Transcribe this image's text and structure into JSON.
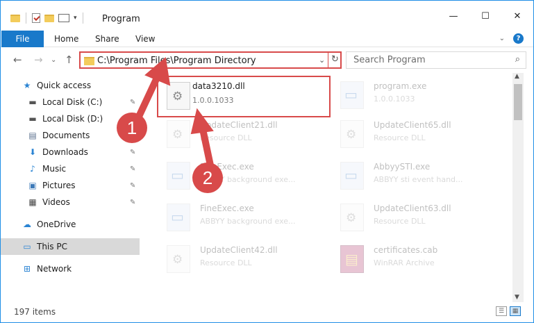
{
  "window": {
    "title": "Program",
    "minimize": "—",
    "maximize": "☐",
    "close": "✕"
  },
  "ribbon": {
    "tabs": [
      "File",
      "Home",
      "Share",
      "View"
    ],
    "collapse": "⌄",
    "help": "?"
  },
  "address": {
    "path": "C:\\Program Files\\Program Directory",
    "dropdown": "⌄",
    "refresh": "↻"
  },
  "nav": {
    "back": "←",
    "forward": "→",
    "recent": "⌄",
    "up": "↑"
  },
  "search": {
    "placeholder": "Search Program",
    "icon": "⌕"
  },
  "sidebar": {
    "items": [
      {
        "label": "Quick access",
        "icon": "star-icon",
        "glyph": "★",
        "color": "#2b84d3"
      },
      {
        "label": "Local Disk (C:)",
        "icon": "drive-icon",
        "glyph": "▬",
        "color": "#555555",
        "pinned": true
      },
      {
        "label": "Local Disk (D:)",
        "icon": "drive-icon",
        "glyph": "▬",
        "color": "#555555",
        "pinned": false
      },
      {
        "label": "Documents",
        "icon": "documents-icon",
        "glyph": "▤",
        "color": "#5a6f8c",
        "pinned": true
      },
      {
        "label": "Downloads",
        "icon": "downloads-icon",
        "glyph": "⬇",
        "color": "#2b84d3",
        "pinned": true
      },
      {
        "label": "Music",
        "icon": "music-icon",
        "glyph": "♪",
        "color": "#2b84d3",
        "pinned": true
      },
      {
        "label": "Pictures",
        "icon": "pictures-icon",
        "glyph": "▣",
        "color": "#3d7ab8",
        "pinned": true
      },
      {
        "label": "Videos",
        "icon": "videos-icon",
        "glyph": "▦",
        "color": "#444444",
        "pinned": true
      },
      {
        "label": "OneDrive",
        "icon": "cloud-icon",
        "glyph": "☁",
        "color": "#2b84d3"
      },
      {
        "label": "This PC",
        "icon": "computer-icon",
        "glyph": "▭",
        "color": "#2b84d3",
        "selected": true
      },
      {
        "label": "Network",
        "icon": "network-icon",
        "glyph": "⊞",
        "color": "#2b84d3"
      }
    ],
    "pin_glyph": "📌"
  },
  "files": [
    {
      "name": "data3210.dll",
      "sub": "1.0.0.1033",
      "kind": "dll"
    },
    {
      "name": "program.exe",
      "sub": "1.0.0.1033",
      "kind": "exe"
    },
    {
      "name": "UpdateClient21.dll",
      "sub": "Resource DLL",
      "kind": "dll"
    },
    {
      "name": "UpdateClient65.dll",
      "sub": "Resource DLL",
      "kind": "dll"
    },
    {
      "name": "FineExec.exe",
      "sub": "ABBYY background exe...",
      "kind": "exe"
    },
    {
      "name": "AbbyySTI.exe",
      "sub": "ABBYY sti event hand...",
      "kind": "exe"
    },
    {
      "name": "FineExec.exe",
      "sub": "ABBYY background exe...",
      "kind": "exe"
    },
    {
      "name": "UpdateClient63.dll",
      "sub": "Resource DLL",
      "kind": "dll"
    },
    {
      "name": "UpdateClient42.dll",
      "sub": "Resource DLL",
      "kind": "dll"
    },
    {
      "name": "certificates.cab",
      "sub": "WinRAR Archive",
      "kind": "cab"
    }
  ],
  "status": {
    "count": "197 items"
  },
  "annotations": {
    "step1": "1",
    "step2": "2",
    "color": "#d84a4a"
  }
}
